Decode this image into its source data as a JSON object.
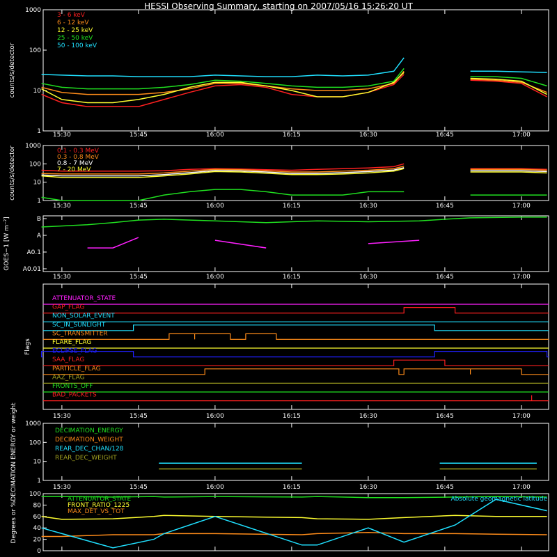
{
  "title": "HESSI Observing Summary, starting on 2007/05/16 15:26:20 UT",
  "time_ticks": [
    "15:30",
    "15:45",
    "16:00",
    "16:15",
    "16:30",
    "16:45",
    "17:00"
  ],
  "chart_data": [
    {
      "id": "low_energy",
      "type": "line",
      "ylabel": "counts/s/detector",
      "yscale": "log",
      "ylim": [
        1,
        1000
      ],
      "ytick_labels": [
        "1",
        "10",
        "100",
        "1000"
      ],
      "x": [
        "15:26",
        "15:30",
        "15:35",
        "15:40",
        "15:45",
        "15:50",
        "15:55",
        "16:00",
        "16:05",
        "16:10",
        "16:15",
        "16:20",
        "16:25",
        "16:30",
        "16:35",
        "16:37",
        "16:47",
        "16:50",
        "16:55",
        "17:00",
        "17:05"
      ],
      "series": [
        {
          "name": "3 - 6 keV",
          "color": "#ff2020",
          "values": [
            8,
            5,
            4,
            4,
            4,
            6,
            9,
            13,
            14,
            12,
            8,
            7,
            7,
            9,
            14,
            25,
            null,
            18,
            17,
            15,
            7
          ]
        },
        {
          "name": "6 - 12 keV",
          "color": "#ff8c1a",
          "values": [
            12,
            9,
            8,
            8,
            8,
            9,
            11,
            15,
            15,
            13,
            11,
            10,
            10,
            11,
            15,
            30,
            null,
            19,
            18,
            16,
            9
          ]
        },
        {
          "name": "12 - 25 keV",
          "color": "#ffff30",
          "values": [
            11,
            6,
            5,
            5,
            6,
            8,
            12,
            16,
            16,
            13,
            10,
            7,
            7,
            9,
            16,
            28,
            null,
            20,
            19,
            17,
            8
          ]
        },
        {
          "name": "25 - 50 keV",
          "color": "#20e020",
          "values": [
            15,
            12,
            11,
            11,
            11,
            12,
            14,
            18,
            17,
            15,
            13,
            12,
            12,
            13,
            17,
            35,
            null,
            22,
            22,
            20,
            13
          ]
        },
        {
          "name": "50 - 100 keV",
          "color": "#20e0ff",
          "values": [
            25,
            24,
            23,
            23,
            22,
            22,
            22,
            24,
            23,
            22,
            22,
            24,
            23,
            24,
            30,
            65,
            null,
            30,
            30,
            29,
            28
          ]
        }
      ]
    },
    {
      "id": "high_energy",
      "type": "line",
      "ylabel": "counts/s/detector",
      "yscale": "log",
      "ylim": [
        1,
        1000
      ],
      "ytick_labels": [
        "1",
        "10",
        "100",
        "1000"
      ],
      "x": [
        "15:26",
        "15:30",
        "15:35",
        "15:40",
        "15:45",
        "15:50",
        "15:55",
        "16:00",
        "16:05",
        "16:10",
        "16:15",
        "16:20",
        "16:25",
        "16:30",
        "16:35",
        "16:37",
        "16:47",
        "16:50",
        "16:55",
        "17:00",
        "17:05"
      ],
      "series": [
        {
          "name": "0.1 - 0.3 MeV",
          "color": "#ff2020",
          "values": [
            45,
            40,
            40,
            40,
            40,
            42,
            50,
            55,
            52,
            48,
            45,
            50,
            55,
            60,
            70,
            100,
            null,
            55,
            55,
            55,
            50
          ]
        },
        {
          "name": "0.3 - 0.8 MeV",
          "color": "#ff8c1a",
          "values": [
            30,
            28,
            28,
            28,
            28,
            32,
            40,
            50,
            48,
            42,
            36,
            36,
            40,
            45,
            55,
            75,
            null,
            50,
            50,
            50,
            45
          ]
        },
        {
          "name": "0.8 - 7 MeV",
          "color": "#ffffff",
          "values": [
            25,
            22,
            22,
            22,
            22,
            26,
            33,
            43,
            41,
            36,
            30,
            30,
            33,
            38,
            46,
            62,
            null,
            42,
            42,
            42,
            38
          ]
        },
        {
          "name": "7 - 20 MeV",
          "color": "#ffff30",
          "values": [
            22,
            18,
            18,
            18,
            18,
            22,
            28,
            38,
            36,
            31,
            26,
            26,
            28,
            32,
            40,
            55,
            null,
            36,
            36,
            36,
            32
          ]
        },
        {
          "name": "",
          "color": "#20e020",
          "values": [
            1.5,
            1,
            1,
            1,
            1,
            2,
            3,
            4,
            4,
            3,
            2,
            2,
            2,
            3,
            3,
            3,
            null,
            2,
            2,
            2,
            2
          ]
        }
      ]
    },
    {
      "id": "goes",
      "type": "line",
      "ylabel": "GOES−1 [W m⁻²]",
      "yscale": "log",
      "ytick_labels": [
        "B",
        "A",
        "A0.1",
        "A0.01"
      ],
      "x": [
        "15:26",
        "15:35",
        "15:40",
        "15:45",
        "15:50",
        "16:00",
        "16:10",
        "16:15",
        "16:20",
        "16:30",
        "16:40",
        "16:45",
        "16:50",
        "17:00",
        "17:05"
      ],
      "series": [
        {
          "name": "",
          "color": "#20e020",
          "values": [
            1.2e-07,
            1.4e-07,
            1.6e-07,
            1.9e-07,
            2e-07,
            1.8e-07,
            1.6e-07,
            1.7e-07,
            1.8e-07,
            1.7e-07,
            1.8e-07,
            2e-07,
            2.2e-07,
            2.3e-07,
            2.3e-07
          ]
        },
        {
          "name": "",
          "color": "#ff20ff",
          "values": [
            null,
            3e-08,
            3e-08,
            6e-08,
            null,
            5e-08,
            3e-08,
            null,
            null,
            4e-08,
            5e-08,
            null,
            null,
            null,
            null
          ]
        }
      ]
    },
    {
      "id": "flags",
      "type": "line",
      "ylabel": "Flags",
      "flags": [
        {
          "name": "ATTENUATOR_STATE",
          "color": "#ff20ff",
          "on": []
        },
        {
          "name": "GAP_FLAG",
          "color": "#ff2020",
          "on": [
            [
              "16:37",
              "16:47"
            ]
          ]
        },
        {
          "name": "NON_SOLAR_EVENT",
          "color": "#20e0ff",
          "on": []
        },
        {
          "name": "SC_IN_SUNLIGHT",
          "color": "#20e0ff",
          "on": [
            [
              "15:44",
              "16:43"
            ]
          ]
        },
        {
          "name": "SC_TRANSMITTER",
          "color": "#ff8c1a",
          "on": [
            [
              "15:51",
              "15:56"
            ],
            [
              "15:56",
              "16:03"
            ],
            [
              "16:06",
              "16:12"
            ]
          ]
        },
        {
          "name": "FLARE_FLAG",
          "color": "#ffff30",
          "on": []
        },
        {
          "name": "ECLIPSE_FLAG",
          "color": "#2020ff",
          "on": [
            [
              "15:26",
              "15:44"
            ],
            [
              "16:43",
              "17:05"
            ]
          ]
        },
        {
          "name": "SAA_FLAG",
          "color": "#ff2020",
          "on": [
            [
              "16:35",
              "16:45"
            ]
          ]
        },
        {
          "name": "PARTICLE_FLAG",
          "color": "#ff8c1a",
          "on": [
            [
              "15:58",
              "16:36"
            ],
            [
              "16:37",
              "16:50"
            ],
            [
              "16:50",
              "17:00"
            ]
          ]
        },
        {
          "name": "AAZ_FLAG",
          "color": "#a0a020",
          "on": []
        },
        {
          "name": "FRONTS_OFF",
          "color": "#20e020",
          "on": []
        },
        {
          "name": "BAD_PACKETS",
          "color": "#ff2020",
          "on": [
            [
              "17:02",
              "17:02"
            ]
          ]
        }
      ]
    },
    {
      "id": "decimation",
      "type": "line",
      "ylabel": "DECIMATION ENERGY or weight",
      "yscale": "log",
      "ylim": [
        1,
        1000
      ],
      "ytick_labels": [
        "1",
        "10",
        "100",
        "1000"
      ],
      "x": [
        "15:26",
        "15:48",
        "15:49",
        "16:17",
        "16:18",
        "16:44",
        "16:45",
        "17:03",
        "17:05"
      ],
      "series": [
        {
          "name": "DECIMATION_ENERGY",
          "color": "#20e020",
          "values": []
        },
        {
          "name": "DECIMATION_WEIGHT",
          "color": "#ff8c1a",
          "values": []
        },
        {
          "name": "REAR_DEC_CHAN/128",
          "color": "#20e0ff",
          "values": [
            8,
            null,
            8,
            8,
            null,
            8,
            8,
            8,
            null
          ]
        },
        {
          "name": "REAR_DEC_WEIGHT",
          "color": "#a0a020",
          "values": [
            4,
            null,
            4,
            4,
            null,
            4,
            4,
            4,
            null
          ]
        }
      ]
    },
    {
      "id": "geometry",
      "type": "line",
      "ylabel": "Degrees or %",
      "ylim": [
        0,
        100
      ],
      "ytick_labels": [
        "0",
        "20",
        "40",
        "60",
        "80",
        "100"
      ],
      "annotation": "Absolute geomagnetic latitude",
      "x": [
        "15:26",
        "15:30",
        "15:40",
        "15:48",
        "15:50",
        "16:00",
        "16:17",
        "16:20",
        "16:30",
        "16:37",
        "16:47",
        "16:55",
        "17:05"
      ],
      "series": [
        {
          "name": "ATTENUATOR_STATE",
          "color": "#20e020",
          "values": [
            95,
            95,
            94,
            95,
            94,
            95,
            94,
            95,
            93,
            93,
            94,
            95,
            94
          ]
        },
        {
          "name": "FRONT_RATIO_1225",
          "color": "#ffff30",
          "values": [
            60,
            55,
            56,
            60,
            62,
            60,
            58,
            56,
            55,
            58,
            62,
            60,
            60
          ]
        },
        {
          "name": "MAX_DET_VS_TOT",
          "color": "#ff8c1a",
          "values": [
            25,
            25,
            28,
            28,
            30,
            30,
            28,
            30,
            32,
            30,
            30,
            29,
            28
          ]
        },
        {
          "name": "",
          "color": "#20e0ff",
          "values": [
            40,
            30,
            5,
            20,
            30,
            60,
            10,
            10,
            40,
            15,
            45,
            90,
            70
          ]
        }
      ]
    }
  ]
}
